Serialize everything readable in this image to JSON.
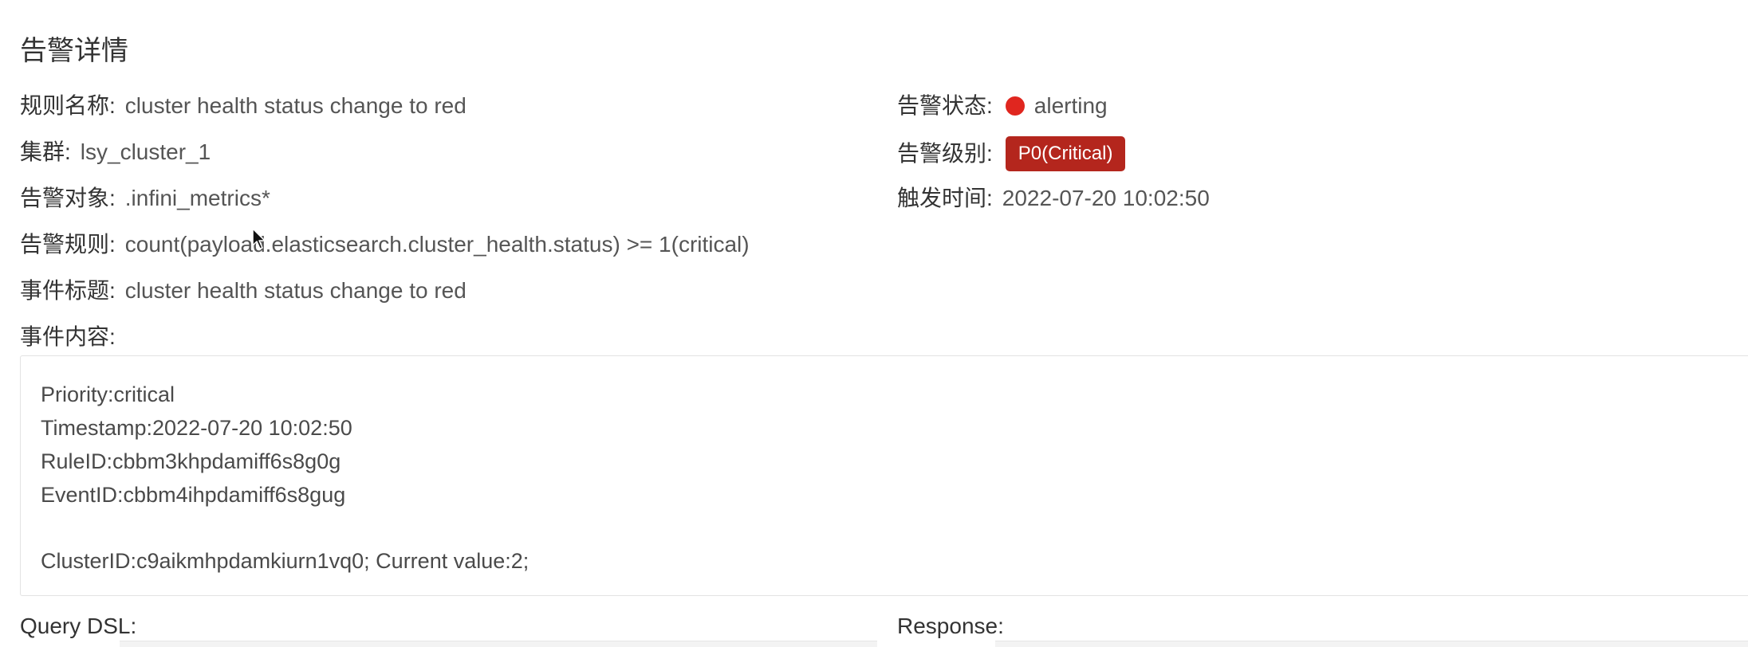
{
  "title": "告警详情",
  "fields": {
    "rule_name": {
      "label": "规则名称:",
      "value": "cluster health status change to red"
    },
    "cluster": {
      "label": "集群:",
      "value": "lsy_cluster_1"
    },
    "target": {
      "label": "告警对象:",
      "value": ".infini_metrics*"
    },
    "rule": {
      "label": "告警规则:",
      "value": "count(payload.elasticsearch.cluster_health.status) >= 1(critical)"
    },
    "event_title": {
      "label": "事件标题:",
      "value": "cluster health status change to red"
    },
    "event_content": {
      "label": "事件内容:"
    },
    "status": {
      "label": "告警状态:",
      "value": "alerting",
      "dot_color": "#e0261f",
      "dot_icon": "status-dot-icon"
    },
    "level": {
      "label": "告警级别:",
      "value": "P0(Critical)",
      "badge_color": "#b4261d"
    },
    "trigger_time": {
      "label": "触发时间:",
      "value": "2022-07-20 10:02:50"
    }
  },
  "event_content_lines": [
    "Priority:critical",
    "Timestamp:2022-07-20 10:02:50",
    "RuleID:cbbm3khpdamiff6s8g0g",
    "EventID:cbbm4ihpdamiff6s8gug",
    "ClusterID:c9aikmhpdamkiurn1vq0; Current value:2;"
  ],
  "query_dsl_label": "Query DSL:",
  "response_label": "Response:",
  "cursor_icon": "mouse-pointer-icon"
}
